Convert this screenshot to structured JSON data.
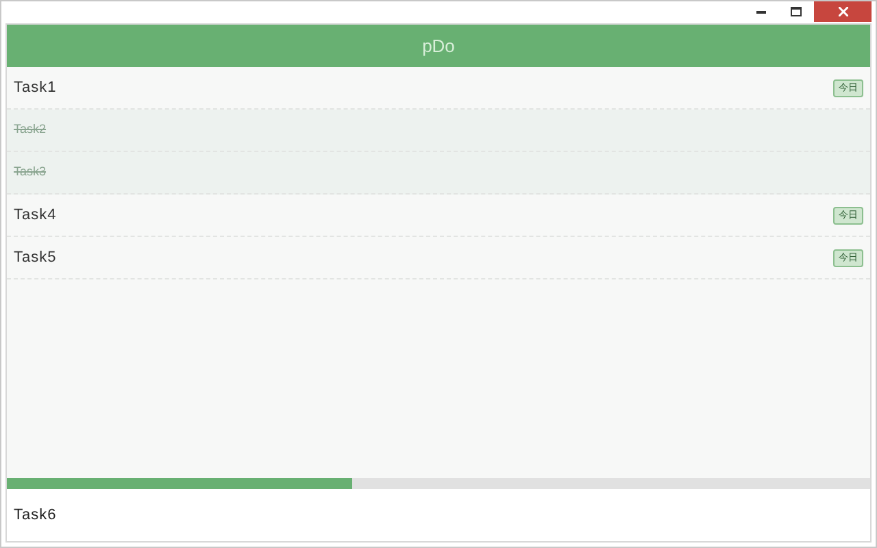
{
  "header": {
    "title": "pDo"
  },
  "tasks": [
    {
      "label": "Task1",
      "done": false,
      "badge": "今日"
    },
    {
      "label": "Task2",
      "done": true
    },
    {
      "label": "Task3",
      "done": true
    },
    {
      "label": "Task4",
      "done": false,
      "badge": "今日"
    },
    {
      "label": "Task5",
      "done": false,
      "badge": "今日"
    }
  ],
  "progress": {
    "level": 0.4
  },
  "input": {
    "value": "Task6"
  }
}
